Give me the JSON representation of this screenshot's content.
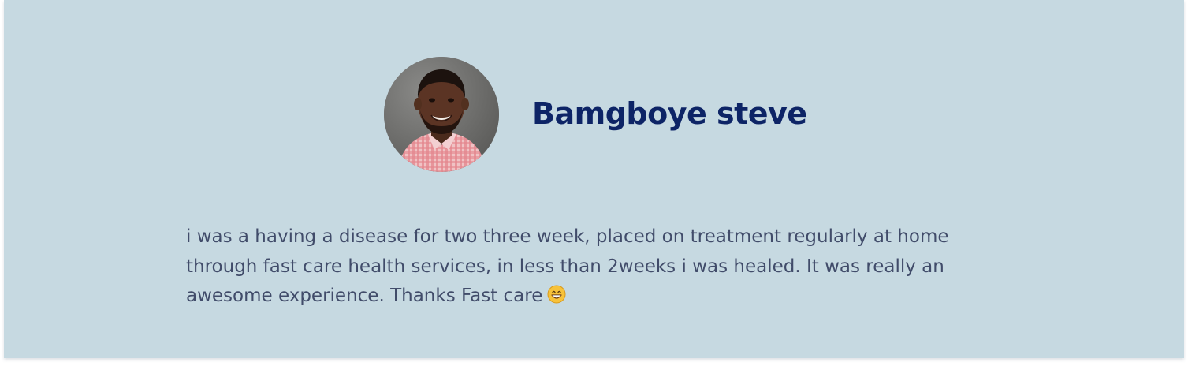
{
  "testimonial": {
    "name": "Bamgboye steve",
    "text": "i was a having a disease for two three week, placed on treatment regularly at home through fast care health services, in less than 2weeks i was healed. It was really an awesome experience. Thanks Fast care",
    "emoji_icon": "grinning-face-icon"
  },
  "colors": {
    "card_background": "#c6d9e1",
    "name": "#0d2466",
    "text": "#414c6a"
  }
}
